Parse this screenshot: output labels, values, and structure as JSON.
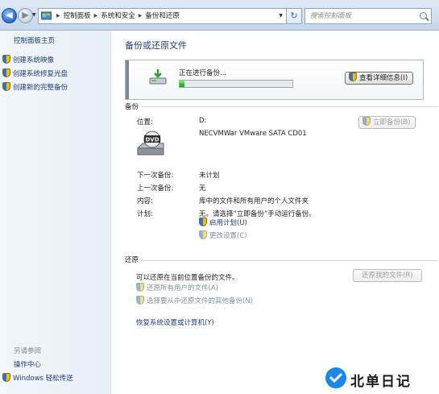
{
  "address_bar": {
    "crumbs": [
      "控制面板",
      "系统和安全",
      "备份和还原"
    ],
    "search_placeholder": "搜索控制面板"
  },
  "left_pane": {
    "home": "控制面板主页",
    "links": [
      "创建系统映像",
      "创建系统修复光盘",
      "创建新的完整备份"
    ],
    "see_also": "另请参阅",
    "bottom_links": [
      "操作中心",
      "Windows 轻松传送"
    ]
  },
  "main": {
    "title": "备份或还原文件",
    "progress": {
      "label": "正在进行备份...",
      "percent": 4,
      "details_button": "查看详细信息(I)"
    },
    "backup": {
      "section": "备份",
      "location_label": "位置:",
      "location_drive": "D:",
      "location_device": "NECVMWar VMware SATA CD01",
      "backup_now_button": "立即备份(B)",
      "next_label": "下一次备份:",
      "next_value": "未计划",
      "last_label": "上一次备份:",
      "last_value": "无",
      "contents_label": "内容:",
      "contents_value": "库中的文件和所有用户的个人文件夹",
      "schedule_label": "计划:",
      "schedule_value": "无。请选择“立即备份”手动运行备份。",
      "enable_schedule": "启用计划(U)",
      "change_settings": "更改设置(C)"
    },
    "restore": {
      "section": "还原",
      "description": "可以还原在当前位置备份的文件。",
      "restore_my_files_button": "还原我的文件(R)",
      "restore_all_users": "还原所有用户的文件(A)",
      "select_another": "选择要从中还原文件的其他备份(N)",
      "recover_system": "恢复系统设置或计算机(Y)"
    }
  },
  "watermark": {
    "text": "北单日记"
  }
}
